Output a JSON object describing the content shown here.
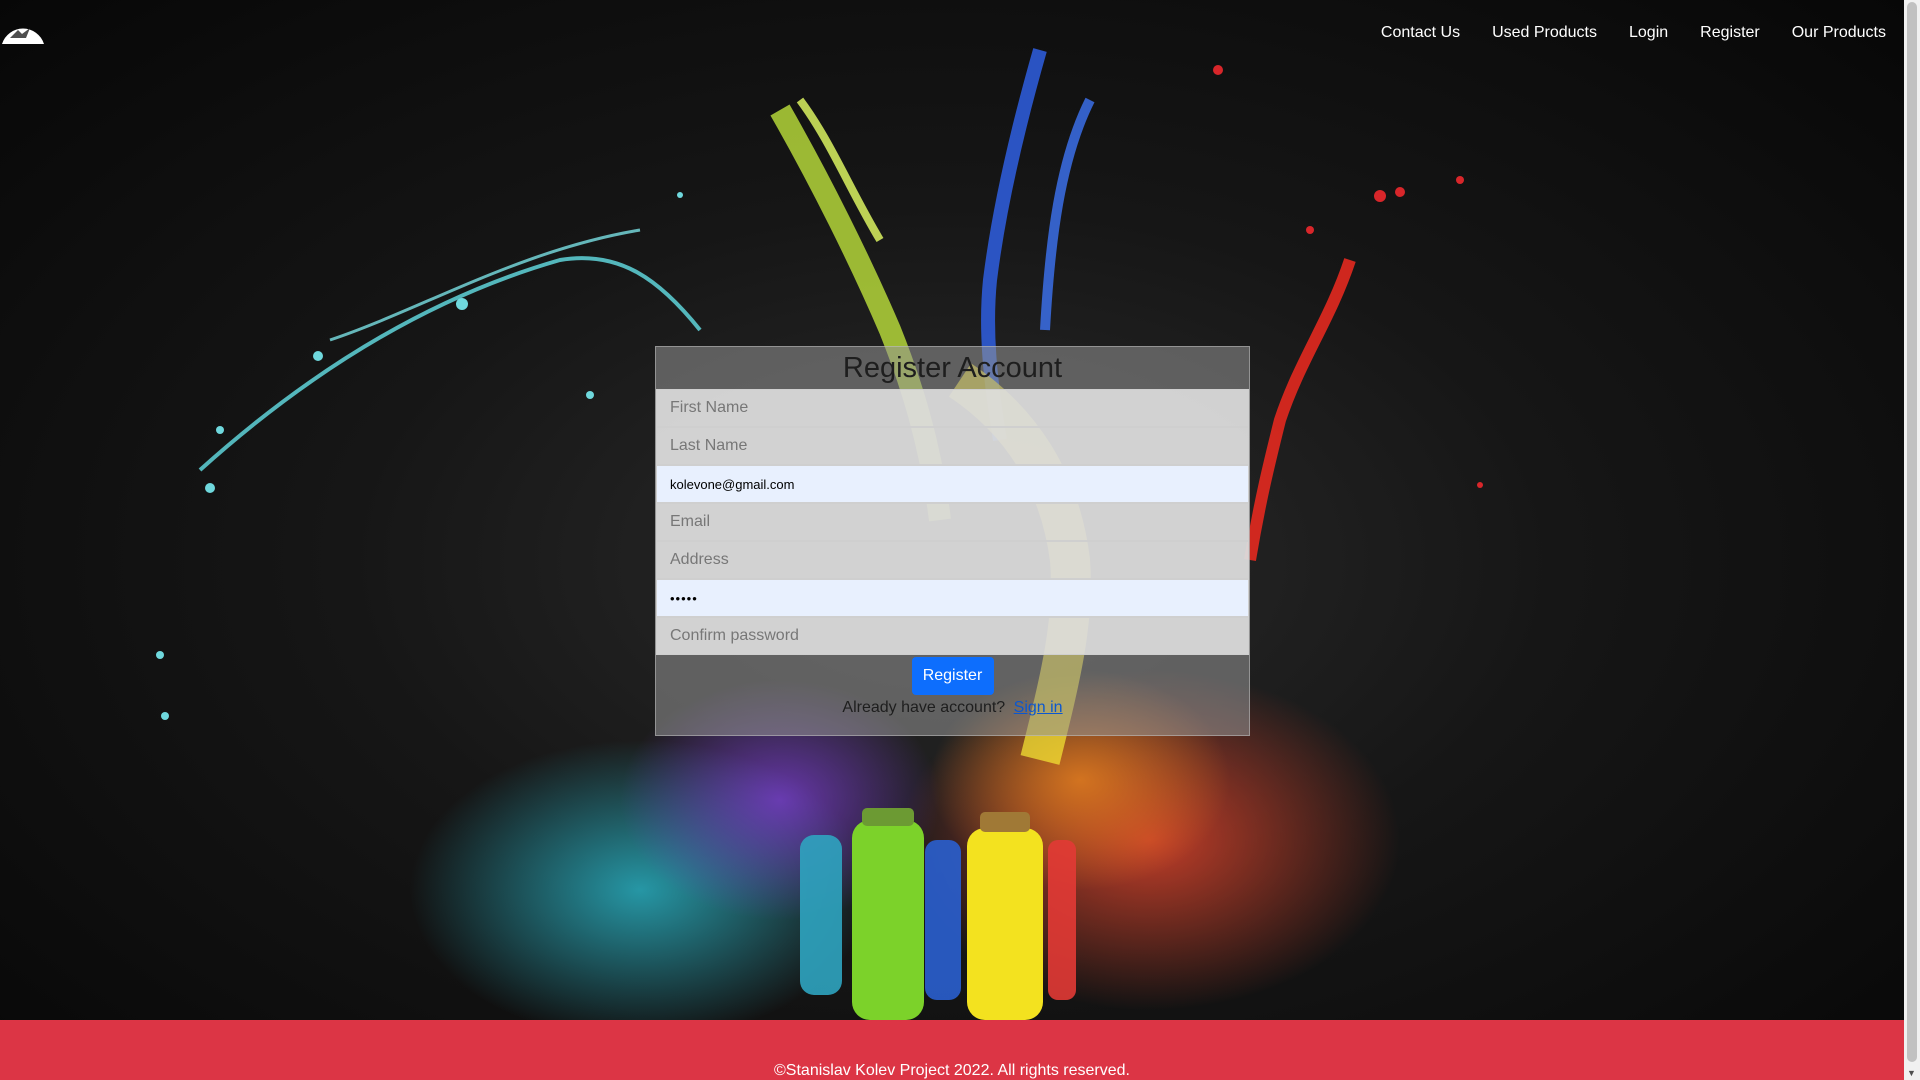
{
  "nav": {
    "logo_icon": "bird-logo-icon",
    "items": [
      {
        "label": "Contact Us"
      },
      {
        "label": "Used Products"
      },
      {
        "label": "Login"
      },
      {
        "label": "Register"
      },
      {
        "label": "Our Products"
      }
    ]
  },
  "form": {
    "title": "Register Account",
    "first_name": {
      "placeholder": "First Name",
      "value": ""
    },
    "last_name": {
      "placeholder": "Last Name",
      "value": ""
    },
    "username": {
      "value": "kolevone@gmail.com"
    },
    "email": {
      "placeholder": "Email",
      "value": ""
    },
    "address": {
      "placeholder": "Address",
      "value": ""
    },
    "password": {
      "value": "•••••"
    },
    "confirm_password": {
      "placeholder": "Confirm password",
      "value": ""
    },
    "submit_label": "Register",
    "signin_prompt": "Already have account?",
    "signin_link": "Sign in"
  },
  "footer": {
    "text": "©Stanislav Kolev Project 2022. All rights reserved."
  },
  "colors": {
    "accent": "#0d6efd",
    "footer": "#dc3545"
  }
}
